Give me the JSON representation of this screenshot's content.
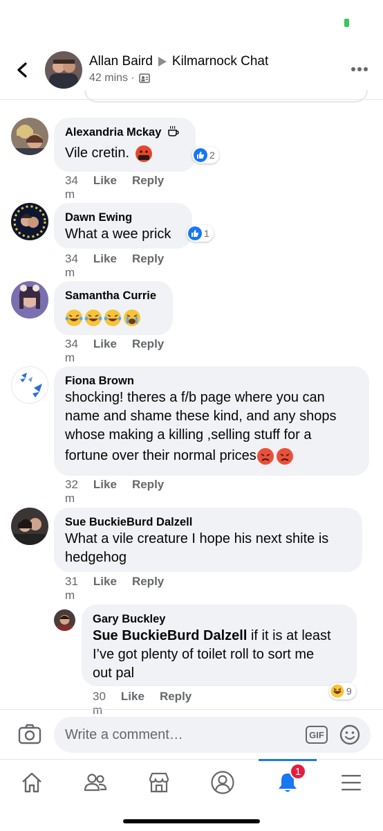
{
  "header": {
    "author": "Allan Baird",
    "group": "Kilmarnock Chat",
    "time": "42 mins ·",
    "back_icon": "chevron-left-icon",
    "more_icon": "more-horizontal-icon"
  },
  "comments": [
    {
      "author": "Alexandria Mckay",
      "text": "Vile cretin.",
      "time": "34 m",
      "like": "Like",
      "reply": "Reply",
      "reaction_count": "2"
    },
    {
      "author": "Dawn Ewing",
      "text": "What a wee prick",
      "time": "34 m",
      "like": "Like",
      "reply": "Reply",
      "reaction_count": "1"
    },
    {
      "author": "Samantha Currie",
      "text": "",
      "time": "34 m",
      "like": "Like",
      "reply": "Reply"
    },
    {
      "author": "Fiona Brown",
      "text_lines": [
        "shocking!   theres a f/b page where you can",
        "name and shame these kind, and any shops",
        "whose making a killing ,selling stuff for a",
        "fortune over their normal prices"
      ],
      "time": "32 m",
      "like": "Like",
      "reply": "Reply"
    },
    {
      "author": "Sue BuckieBurd Dalzell",
      "text_lines": [
        "What a vile creature I hope his next shite is",
        "hedgehog"
      ],
      "time": "31 m",
      "like": "Like",
      "reply": "Reply"
    },
    {
      "author": "Gary Buckley",
      "mention": "Sue BuckieBurd Dalzell",
      "text_lines": [
        " if it is at least",
        "I’ve got plenty of toilet roll to sort me",
        "out pal"
      ],
      "time": "30 m",
      "like": "Like",
      "reply": "Reply",
      "reaction_count": "9"
    }
  ],
  "composer": {
    "placeholder": "Write a comment…",
    "gif_label": "GIF"
  },
  "tabbar": {
    "notification_count": "1"
  },
  "colors": {
    "accent": "#1877f2",
    "bubble": "#f0f2f5",
    "secondary_text": "#65676b",
    "badge": "#e41e3f"
  }
}
